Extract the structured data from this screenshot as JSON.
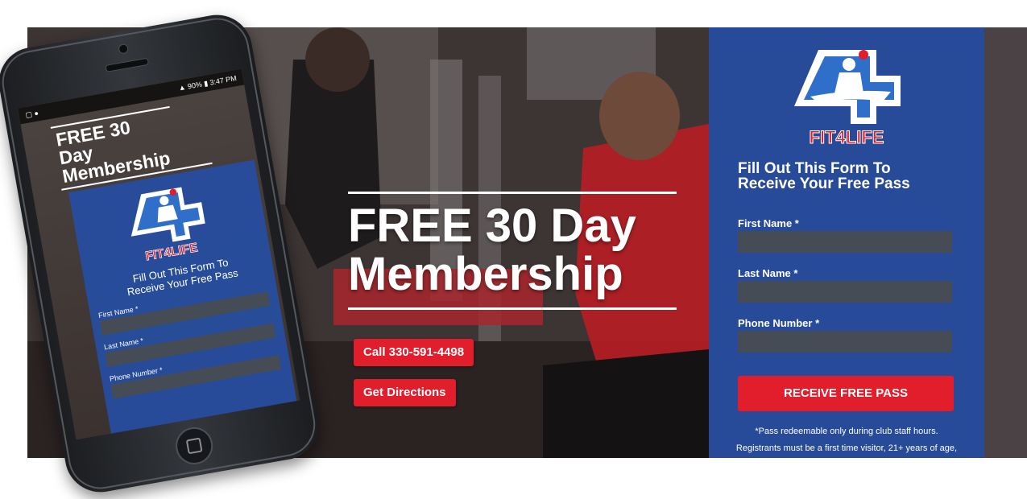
{
  "hero": {
    "title_line1": "FREE 30 Day",
    "title_line2": "Membership",
    "call_button": "Call 330-591-4498",
    "directions_button": "Get Directions"
  },
  "form": {
    "logo_text": "FIT4LIFE",
    "heading_line1": "Fill Out This Form To",
    "heading_line2": "Receive Your Free Pass",
    "fields": [
      {
        "label": "First Name *"
      },
      {
        "label": "Last Name *"
      },
      {
        "label": "Phone Number *"
      }
    ],
    "submit_label": "RECEIVE FREE PASS",
    "disclaimer_line1": "*Pass redeemable only during club staff hours.",
    "disclaimer_line2": "Registrants must be a first time visitor, 21+ years of age,"
  },
  "mobile": {
    "status_time": "3:47 PM",
    "status_battery": "90%",
    "title_line1": "FREE 30",
    "title_line2": "Day",
    "title_line3": "Membership",
    "logo_text": "FIT4LIFE",
    "heading_line1": "Fill Out This Form To",
    "heading_line2": "Receive Your Free Pass",
    "fields": [
      {
        "label": "First Name *"
      },
      {
        "label": "Last Name *"
      },
      {
        "label": "Phone Number *"
      }
    ]
  },
  "colors": {
    "brand_blue": "#264ea0",
    "brand_red": "#e21d2c",
    "input_gray": "#454c56"
  }
}
